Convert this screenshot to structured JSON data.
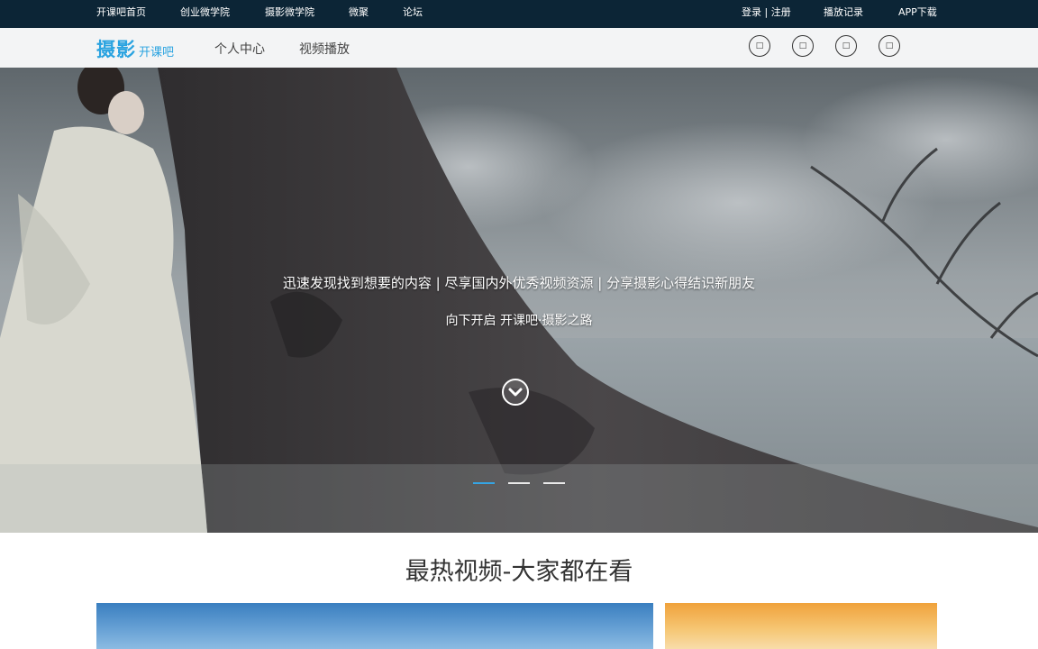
{
  "topbar": {
    "links": [
      "开课吧首页",
      "创业微学院",
      "摄影微学院",
      "微聚",
      "论坛"
    ],
    "login_register": "登录 | 注册",
    "history": "播放记录",
    "app": "APP下载",
    "background": "#0c2536"
  },
  "navbar": {
    "logo_main": "摄影",
    "logo_sub": "开课吧",
    "links": [
      "个人中心",
      "视频播放"
    ],
    "icon_buttons": [
      "□",
      "□",
      "□",
      "□"
    ]
  },
  "hero": {
    "line1": "迅速发现找到想要的内容 | 尽享国内外优秀视频资源 | 分享摄影心得结识新朋友",
    "line2": "向下开启 开课吧·摄影之路",
    "carousel": {
      "slides": 3,
      "active_index": 0
    },
    "accent_color": "#35a5e4"
  },
  "section": {
    "title": "最热视频-大家都在看"
  }
}
